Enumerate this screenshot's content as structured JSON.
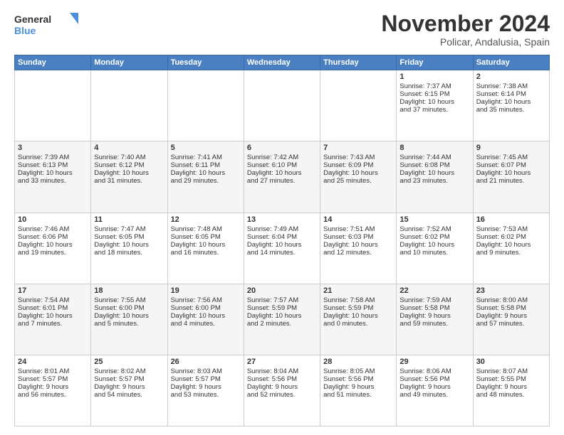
{
  "logo": {
    "line1": "General",
    "line2": "Blue"
  },
  "title": "November 2024",
  "subtitle": "Policar, Andalusia, Spain",
  "headers": [
    "Sunday",
    "Monday",
    "Tuesday",
    "Wednesday",
    "Thursday",
    "Friday",
    "Saturday"
  ],
  "weeks": [
    [
      {
        "day": "",
        "info": ""
      },
      {
        "day": "",
        "info": ""
      },
      {
        "day": "",
        "info": ""
      },
      {
        "day": "",
        "info": ""
      },
      {
        "day": "",
        "info": ""
      },
      {
        "day": "1",
        "info": "Sunrise: 7:37 AM\nSunset: 6:15 PM\nDaylight: 10 hours\nand 37 minutes."
      },
      {
        "day": "2",
        "info": "Sunrise: 7:38 AM\nSunset: 6:14 PM\nDaylight: 10 hours\nand 35 minutes."
      }
    ],
    [
      {
        "day": "3",
        "info": "Sunrise: 7:39 AM\nSunset: 6:13 PM\nDaylight: 10 hours\nand 33 minutes."
      },
      {
        "day": "4",
        "info": "Sunrise: 7:40 AM\nSunset: 6:12 PM\nDaylight: 10 hours\nand 31 minutes."
      },
      {
        "day": "5",
        "info": "Sunrise: 7:41 AM\nSunset: 6:11 PM\nDaylight: 10 hours\nand 29 minutes."
      },
      {
        "day": "6",
        "info": "Sunrise: 7:42 AM\nSunset: 6:10 PM\nDaylight: 10 hours\nand 27 minutes."
      },
      {
        "day": "7",
        "info": "Sunrise: 7:43 AM\nSunset: 6:09 PM\nDaylight: 10 hours\nand 25 minutes."
      },
      {
        "day": "8",
        "info": "Sunrise: 7:44 AM\nSunset: 6:08 PM\nDaylight: 10 hours\nand 23 minutes."
      },
      {
        "day": "9",
        "info": "Sunrise: 7:45 AM\nSunset: 6:07 PM\nDaylight: 10 hours\nand 21 minutes."
      }
    ],
    [
      {
        "day": "10",
        "info": "Sunrise: 7:46 AM\nSunset: 6:06 PM\nDaylight: 10 hours\nand 19 minutes."
      },
      {
        "day": "11",
        "info": "Sunrise: 7:47 AM\nSunset: 6:05 PM\nDaylight: 10 hours\nand 18 minutes."
      },
      {
        "day": "12",
        "info": "Sunrise: 7:48 AM\nSunset: 6:05 PM\nDaylight: 10 hours\nand 16 minutes."
      },
      {
        "day": "13",
        "info": "Sunrise: 7:49 AM\nSunset: 6:04 PM\nDaylight: 10 hours\nand 14 minutes."
      },
      {
        "day": "14",
        "info": "Sunrise: 7:51 AM\nSunset: 6:03 PM\nDaylight: 10 hours\nand 12 minutes."
      },
      {
        "day": "15",
        "info": "Sunrise: 7:52 AM\nSunset: 6:02 PM\nDaylight: 10 hours\nand 10 minutes."
      },
      {
        "day": "16",
        "info": "Sunrise: 7:53 AM\nSunset: 6:02 PM\nDaylight: 10 hours\nand 9 minutes."
      }
    ],
    [
      {
        "day": "17",
        "info": "Sunrise: 7:54 AM\nSunset: 6:01 PM\nDaylight: 10 hours\nand 7 minutes."
      },
      {
        "day": "18",
        "info": "Sunrise: 7:55 AM\nSunset: 6:00 PM\nDaylight: 10 hours\nand 5 minutes."
      },
      {
        "day": "19",
        "info": "Sunrise: 7:56 AM\nSunset: 6:00 PM\nDaylight: 10 hours\nand 4 minutes."
      },
      {
        "day": "20",
        "info": "Sunrise: 7:57 AM\nSunset: 5:59 PM\nDaylight: 10 hours\nand 2 minutes."
      },
      {
        "day": "21",
        "info": "Sunrise: 7:58 AM\nSunset: 5:59 PM\nDaylight: 10 hours\nand 0 minutes."
      },
      {
        "day": "22",
        "info": "Sunrise: 7:59 AM\nSunset: 5:58 PM\nDaylight: 9 hours\nand 59 minutes."
      },
      {
        "day": "23",
        "info": "Sunrise: 8:00 AM\nSunset: 5:58 PM\nDaylight: 9 hours\nand 57 minutes."
      }
    ],
    [
      {
        "day": "24",
        "info": "Sunrise: 8:01 AM\nSunset: 5:57 PM\nDaylight: 9 hours\nand 56 minutes."
      },
      {
        "day": "25",
        "info": "Sunrise: 8:02 AM\nSunset: 5:57 PM\nDaylight: 9 hours\nand 54 minutes."
      },
      {
        "day": "26",
        "info": "Sunrise: 8:03 AM\nSunset: 5:57 PM\nDaylight: 9 hours\nand 53 minutes."
      },
      {
        "day": "27",
        "info": "Sunrise: 8:04 AM\nSunset: 5:56 PM\nDaylight: 9 hours\nand 52 minutes."
      },
      {
        "day": "28",
        "info": "Sunrise: 8:05 AM\nSunset: 5:56 PM\nDaylight: 9 hours\nand 51 minutes."
      },
      {
        "day": "29",
        "info": "Sunrise: 8:06 AM\nSunset: 5:56 PM\nDaylight: 9 hours\nand 49 minutes."
      },
      {
        "day": "30",
        "info": "Sunrise: 8:07 AM\nSunset: 5:55 PM\nDaylight: 9 hours\nand 48 minutes."
      }
    ]
  ]
}
